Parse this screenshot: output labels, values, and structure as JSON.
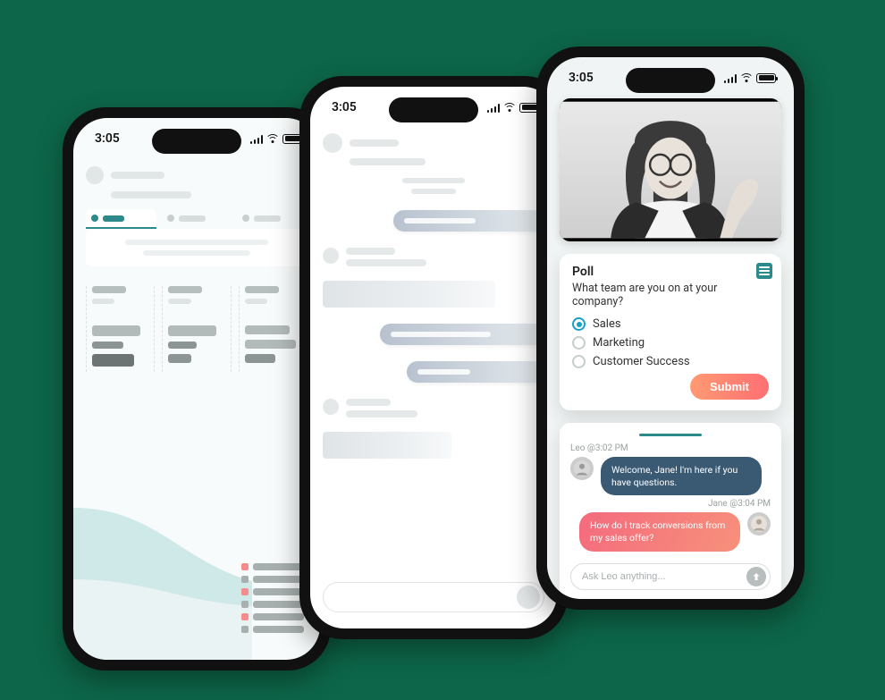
{
  "status": {
    "time": "3:05"
  },
  "poll": {
    "heading": "Poll",
    "question": "What team are you on at your company?",
    "options": [
      "Sales",
      "Marketing",
      "Customer Success"
    ],
    "selected_index": 0,
    "submit_label": "Submit"
  },
  "chat": {
    "messages": [
      {
        "author": "Leo",
        "time": "3:02 PM",
        "text": "Welcome, Jane! I'm here if you have questions.",
        "side": "left"
      },
      {
        "author": "Jane",
        "time": "3:04 PM",
        "text": "How do I track conversions from my sales offer?",
        "side": "right"
      }
    ],
    "meta_leo": "Leo @3:02 PM",
    "meta_jane": "Jane @3:04 PM",
    "input_placeholder": "Ask Leo anything..."
  },
  "colors": {
    "bg": "#0d6649",
    "teal": "#2d8a8a",
    "cyan": "#19a0c9",
    "leo_bubble": "#3a5a74",
    "jane_grad_a": "#f46a7e",
    "jane_grad_b": "#f7917b",
    "submit_grad_a": "#ff9a73",
    "submit_grad_b": "#ff6f72"
  }
}
